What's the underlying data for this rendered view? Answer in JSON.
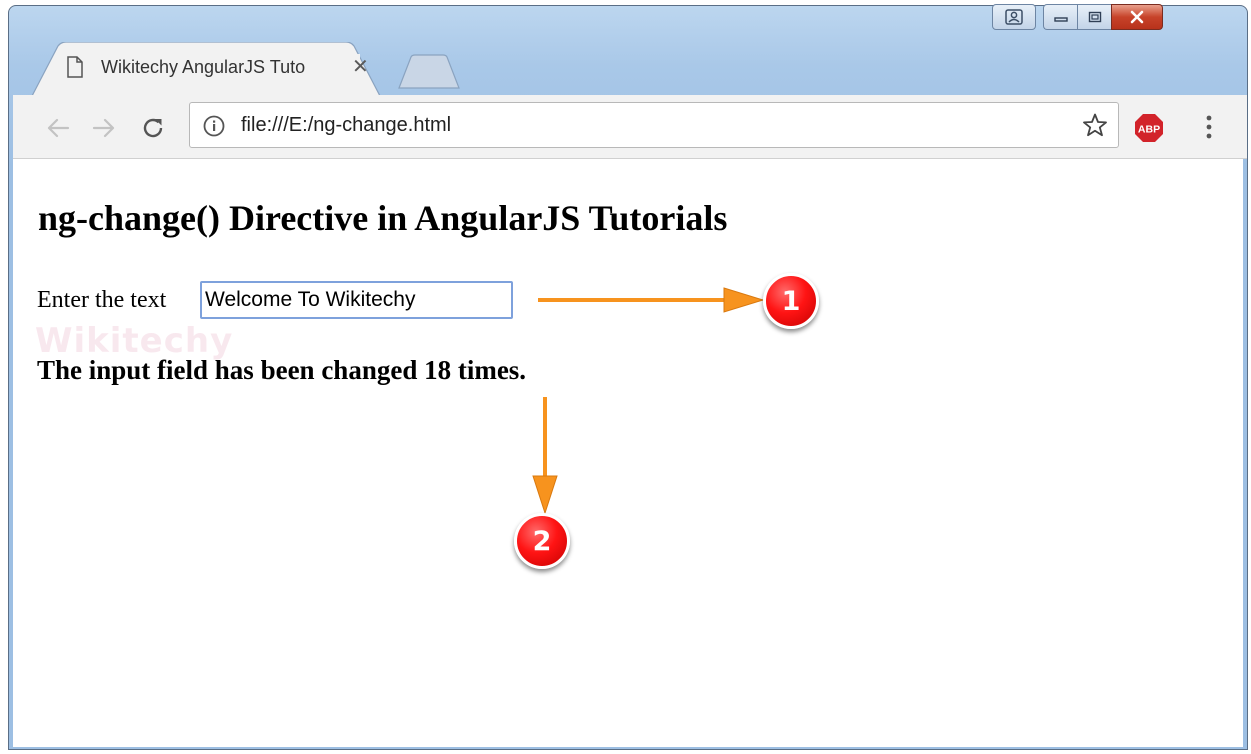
{
  "browser": {
    "tab_title": "Wikitechy AngularJS Tuto",
    "address_url": "file:///E:/ng-change.html",
    "extension_label": "ABP"
  },
  "icons": {
    "profile": "profile-icon",
    "minimize": "minimize-icon",
    "maximize": "maximize-icon",
    "close": "close-icon",
    "page": "page-icon",
    "tab_close": "close-tab-icon",
    "back": "back-arrow-icon",
    "forward": "forward-arrow-icon",
    "reload": "reload-icon",
    "info": "info-icon",
    "bookmark": "star-icon",
    "adblock": "adblock-plus-icon",
    "menu": "vertical-dots-menu-icon"
  },
  "page": {
    "heading": "ng-change() Directive in AngularJS Tutorials",
    "input_label": "Enter the text",
    "input_value": "Welcome To Wikitechy",
    "result_text": "The input field has been changed 18 times."
  },
  "annotations": [
    {
      "number": "1"
    },
    {
      "number": "2"
    }
  ],
  "colors": {
    "annotation_arrow": "#f7931e",
    "annotation_badge": "#ff1414",
    "window_frame": "#a9c8e8",
    "input_focus_border": "#7ea1dc"
  }
}
